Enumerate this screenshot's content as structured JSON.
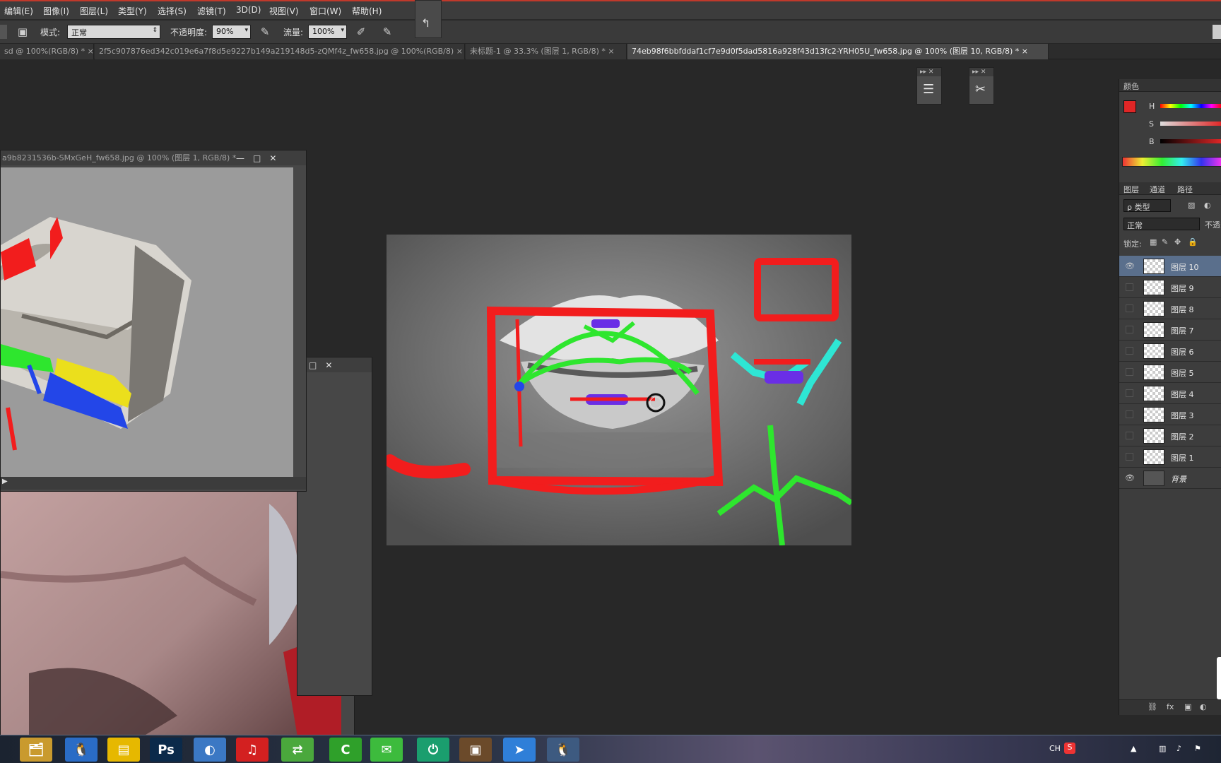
{
  "menu": [
    "编辑(E)",
    "图像(I)",
    "图层(L)",
    "类型(Y)",
    "选择(S)",
    "滤镜(T)",
    "3D(D)",
    "视图(V)",
    "窗口(W)",
    "帮助(H)"
  ],
  "options": {
    "mode_label": "模式:",
    "mode_value": "正常",
    "opacity_label": "不透明度:",
    "opacity_value": "90%",
    "flow_label": "流量:",
    "flow_value": "100%"
  },
  "tabs": [
    {
      "label": "sd @ 100%(RGB/8) *",
      "active": false
    },
    {
      "label": "2f5c907876ed342c019e6a7f8d5e9227b149a219148d5-zQMf4z_fw658.jpg @ 100%(RGB/8)",
      "active": false
    },
    {
      "label": "未标题-1 @ 33.3% (图层 1, RGB/8) *",
      "active": false
    },
    {
      "label": "74eb98f6bbfddaf1cf7e9d0f5dad5816a928f43d13fc2-YRH05U_fw658.jpg @ 100% (图层 10, RGB/8) *",
      "active": true
    }
  ],
  "windows": {
    "doc1_title": "a9b8231536b-SMxGeH_fw658.jpg @ 100% (图层 1, RGB/8) *"
  },
  "color_panel": {
    "title": "颜色",
    "h_label": "H",
    "s_label": "S",
    "b_label": "B",
    "foreground": "#e02626",
    "background": "#ffffff"
  },
  "layers_panel": {
    "tabs": [
      "图层",
      "通道",
      "路径"
    ],
    "filter_label": "ρ 类型",
    "blend_mode": "正常",
    "opacity_short": "不透",
    "lock_label": "锁定:",
    "layers": [
      {
        "name": "图层 10",
        "visible": true,
        "selected": true
      },
      {
        "name": "图层 9",
        "visible": false,
        "selected": false
      },
      {
        "name": "图层 8",
        "visible": false,
        "selected": false
      },
      {
        "name": "图层 7",
        "visible": false,
        "selected": false
      },
      {
        "name": "图层 6",
        "visible": false,
        "selected": false
      },
      {
        "name": "图层 5",
        "visible": false,
        "selected": false
      },
      {
        "name": "图层 4",
        "visible": false,
        "selected": false
      },
      {
        "name": "图层 3",
        "visible": false,
        "selected": false
      },
      {
        "name": "图层 2",
        "visible": false,
        "selected": false
      },
      {
        "name": "图层 1",
        "visible": false,
        "selected": false
      },
      {
        "name": "背景",
        "visible": true,
        "selected": false,
        "background": true
      }
    ]
  },
  "taskbar": {
    "apps": [
      {
        "icon": "file-explorer-icon",
        "glyph": "🗂",
        "bg": "#c99a2e"
      },
      {
        "icon": "qq-icon",
        "glyph": "🐧",
        "bg": "#2a6cc6"
      },
      {
        "icon": "notepad-icon",
        "glyph": "▤",
        "bg": "#e6b800"
      },
      {
        "icon": "photoshop-icon",
        "glyph": "Ps",
        "bg": "#0b2a4a"
      },
      {
        "icon": "browser-icon",
        "glyph": "◐",
        "bg": "#3b78c4"
      },
      {
        "icon": "netease-music-icon",
        "glyph": "♫",
        "bg": "#d32020"
      },
      {
        "icon": "green-app-icon",
        "glyph": "⇄",
        "bg": "#4aa83c"
      },
      {
        "icon": "camtasia-icon",
        "glyph": "C",
        "bg": "#2fa02a"
      },
      {
        "icon": "wechat-icon",
        "glyph": "✉",
        "bg": "#3dbb3d"
      },
      {
        "icon": "power-app-icon",
        "glyph": "⏻",
        "bg": "#1a9e6e"
      },
      {
        "icon": "image-viewer-icon",
        "glyph": "▣",
        "bg": "#6b4a2a"
      },
      {
        "icon": "feishu-icon",
        "glyph": "➤",
        "bg": "#2f7fd8"
      },
      {
        "icon": "qq-icon-2",
        "glyph": "🐧",
        "bg": "#3d5a80"
      }
    ],
    "tray_lang": "CH",
    "tray_ime": "S"
  }
}
